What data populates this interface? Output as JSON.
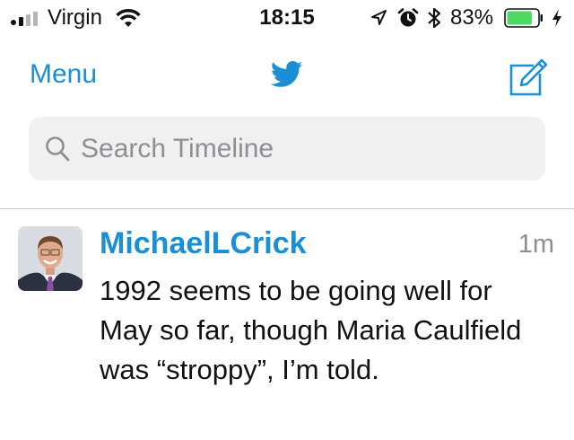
{
  "status_bar": {
    "carrier": "Virgin",
    "time": "18:15",
    "battery_percent": "83%",
    "battery_level": 0.83,
    "signal_bars_filled": 2,
    "signal_bars_total": 4,
    "icons": [
      "signal-icon",
      "wifi-icon",
      "location-icon",
      "alarm-icon",
      "bluetooth-icon",
      "battery-icon",
      "charging-icon"
    ]
  },
  "nav": {
    "menu_label": "Menu",
    "logo_icon": "twitter-bird-icon",
    "compose_icon": "compose-icon"
  },
  "search": {
    "placeholder": "Search Timeline",
    "icon": "search-icon"
  },
  "tweet": {
    "username": "MichaelLCrick",
    "time_ago": "1m",
    "text": "1992 seems to be going well for May so far, though Maria Caulfield was “stroppy”, I’m told."
  },
  "colors": {
    "accent": "#1a8fd6",
    "battery_green": "#4cd964",
    "search_bg": "#eef0f2",
    "secondary_text": "#8e8e93"
  }
}
